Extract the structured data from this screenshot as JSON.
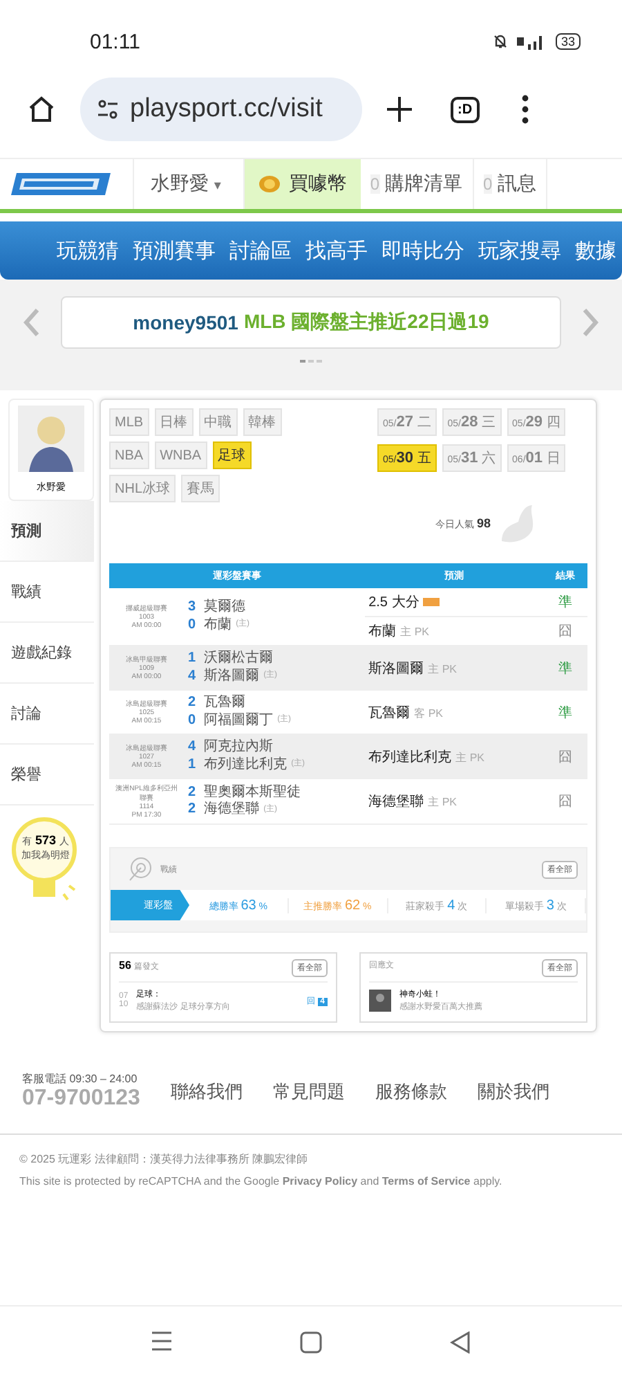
{
  "status_bar": {
    "time": "01:11",
    "battery": "33"
  },
  "browser": {
    "url": "playsport.cc/visit",
    "tabs_label": ":D"
  },
  "site_header": {
    "user": "水野愛",
    "caret": "▾",
    "coins": "買噱幣",
    "cart_count": "0",
    "cart": "購牌清單",
    "msg_count": "0",
    "messages": "訊息"
  },
  "nav": [
    "玩競猜",
    "預測賽事",
    "討論區",
    "找高手",
    "即時比分",
    "玩家搜尋",
    "數據"
  ],
  "banner": {
    "user": "money9501",
    "text": "MLB 國際盤主推近22日過19"
  },
  "profile": {
    "name": "水野愛",
    "menu": [
      {
        "label": "預測",
        "selected": true
      },
      {
        "label": "戰績",
        "selected": false
      },
      {
        "label": "遊戲紀錄",
        "selected": false
      },
      {
        "label": "討論",
        "selected": false
      },
      {
        "label": "榮譽",
        "selected": false
      }
    ],
    "fans_prefix": "有",
    "fans": "573",
    "fans_suffix": "人",
    "fans_note": "加我為明燈"
  },
  "leagues": [
    {
      "label": "MLB",
      "selected": false
    },
    {
      "label": "日棒",
      "selected": false
    },
    {
      "label": "中職",
      "selected": false
    },
    {
      "label": "韓棒",
      "selected": false
    },
    {
      "label": "NBA",
      "selected": false
    },
    {
      "label": "WNBA",
      "selected": false
    },
    {
      "label": "足球",
      "selected": true
    },
    {
      "label": "NHL冰球",
      "selected": false
    },
    {
      "label": "賽馬",
      "selected": false
    }
  ],
  "dates": [
    {
      "date": "05/27",
      "day": "二",
      "selected": false
    },
    {
      "date": "05/28",
      "day": "三",
      "selected": false
    },
    {
      "date": "05/29",
      "day": "四",
      "selected": false
    },
    {
      "date": "05/30",
      "day": "五",
      "selected": true
    },
    {
      "date": "05/31",
      "day": "六",
      "selected": false
    },
    {
      "date": "06/01",
      "day": "日",
      "selected": false
    }
  ],
  "popularity": {
    "label": "今日人氣",
    "value": "98"
  },
  "table": {
    "columns": [
      "運彩盤賽事",
      "預測",
      "結果"
    ],
    "rows": [
      {
        "league": "挪威超級聯賽",
        "no": "1003",
        "time": "AM 00:00",
        "teams": [
          {
            "score": "3",
            "name": "莫爾德"
          },
          {
            "score": "0",
            "name": "布蘭",
            "mark": "(主)"
          }
        ],
        "picks": [
          {
            "pick": "2.5 大分",
            "tag": true,
            "result": "準",
            "hit": true
          },
          {
            "pick": "布蘭",
            "note": "主 PK",
            "result": "囧",
            "hit": false
          }
        ]
      },
      {
        "league": "冰島甲級聯賽",
        "no": "1009",
        "time": "AM 00:00",
        "teams": [
          {
            "score": "1",
            "name": "沃爾松古爾"
          },
          {
            "score": "4",
            "name": "斯洛圖爾",
            "mark": "(主)"
          }
        ],
        "picks": [
          {
            "pick": "斯洛圖爾",
            "note": "主 PK",
            "result": "準",
            "hit": true
          }
        ]
      },
      {
        "league": "冰島超級聯賽",
        "no": "1025",
        "time": "AM 00:15",
        "teams": [
          {
            "score": "2",
            "name": "瓦魯爾"
          },
          {
            "score": "0",
            "name": "阿福圖爾丁",
            "mark": "(主)"
          }
        ],
        "picks": [
          {
            "pick": "瓦魯爾",
            "note": "客 PK",
            "result": "準",
            "hit": true
          }
        ]
      },
      {
        "league": "冰島超級聯賽",
        "no": "1027",
        "time": "AM 00:15",
        "teams": [
          {
            "score": "4",
            "name": "阿克拉內斯"
          },
          {
            "score": "1",
            "name": "布列達比利克",
            "mark": "(主)"
          }
        ],
        "picks": [
          {
            "pick": "布列達比利克",
            "note": "主 PK",
            "result": "囧",
            "hit": false
          }
        ]
      },
      {
        "league": "澳洲NPL維多利亞州聯賽",
        "no": "1114",
        "time": "PM 17:30",
        "teams": [
          {
            "score": "2",
            "name": "聖奧爾本斯聖徒"
          },
          {
            "score": "2",
            "name": "海德堡聯",
            "mark": "(主)"
          }
        ],
        "picks": [
          {
            "pick": "海德堡聯",
            "note": "主 PK",
            "result": "囧",
            "hit": false
          }
        ]
      }
    ]
  },
  "record": {
    "title": "戰績",
    "more": "看全部",
    "tab": "運彩盤",
    "stats": [
      {
        "label": "總勝率",
        "value": "63",
        "unit": "%",
        "kind": "blue"
      },
      {
        "label": "主推勝率",
        "value": "62",
        "unit": "%",
        "kind": "orange"
      },
      {
        "label": "莊家殺手",
        "value": "4",
        "unit": "次",
        "kind": "grey"
      },
      {
        "label": "單場殺手",
        "value": "3",
        "unit": "次",
        "kind": "grey"
      }
    ]
  },
  "posts": {
    "count": "56",
    "title": "篇發文",
    "more": "看全部",
    "day": "07",
    "month": "10",
    "post_title": "足球：",
    "post_text": "感謝蘇法沙 足球分享方向",
    "reply_label": "回",
    "replies": "4"
  },
  "replies_panel": {
    "title": "回應文",
    "more": "看全部",
    "author": "神奇小蛙！",
    "text": "感謝水野愛百萬大推薦"
  },
  "footer": {
    "hotline": "客服電話 09:30 – 24:00",
    "phone": "07-9700123",
    "links": [
      "聯絡我們",
      "常見問題",
      "服務條款",
      "關於我們"
    ],
    "copyright": "© 2025 玩運彩 法律顧問：漢英得力法律事務所 陳鵬宏律師",
    "recaptcha": "This site is protected by reCAPTCHA and the Google **Privacy Policy** and **Terms of Service** apply."
  }
}
